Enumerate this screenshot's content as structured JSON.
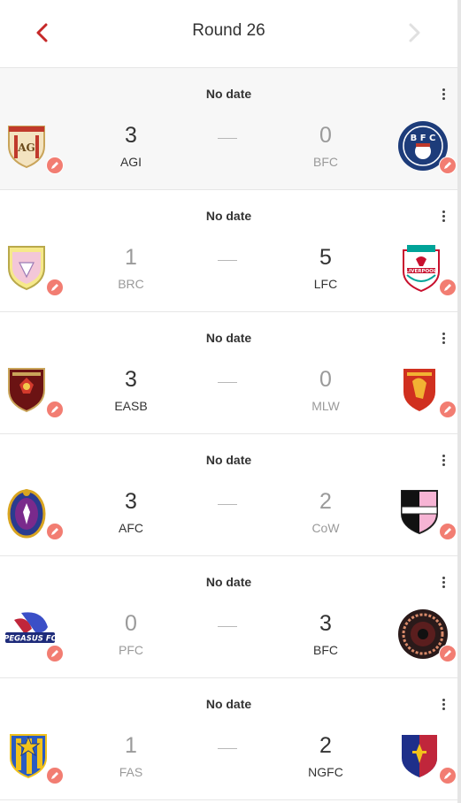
{
  "header": {
    "title": "Round 26",
    "prev_icon": "chevron-left-icon",
    "next_icon": "chevron-right-icon",
    "accent": "#c62828"
  },
  "matches": [
    {
      "date": "No date",
      "home": {
        "abbr": "AGI",
        "score": "3",
        "logo": "agi-crest"
      },
      "away": {
        "abbr": "BFC",
        "score": "0",
        "logo": "bfc-roundel"
      }
    },
    {
      "date": "No date",
      "home": {
        "abbr": "BRC",
        "score": "1",
        "logo": "brc-crest"
      },
      "away": {
        "abbr": "LFC",
        "score": "5",
        "logo": "lfc-crest"
      }
    },
    {
      "date": "No date",
      "home": {
        "abbr": "EASB",
        "score": "3",
        "logo": "easb-crest"
      },
      "away": {
        "abbr": "MLW",
        "score": "0",
        "logo": "mlw-crest"
      }
    },
    {
      "date": "No date",
      "home": {
        "abbr": "AFC",
        "score": "3",
        "logo": "afc-crest"
      },
      "away": {
        "abbr": "CoW",
        "score": "2",
        "logo": "cow-crest"
      }
    },
    {
      "date": "No date",
      "home": {
        "abbr": "PFC",
        "score": "0",
        "logo": "pegasus-fc-crest"
      },
      "away": {
        "abbr": "BFC",
        "score": "3",
        "logo": "bfc-wheel-crest"
      }
    },
    {
      "date": "No date",
      "home": {
        "abbr": "FAS",
        "score": "1",
        "logo": "fas-star-crest"
      },
      "away": {
        "abbr": "NGFC",
        "score": "2",
        "logo": "ngfc-shield"
      }
    }
  ],
  "colors": {
    "edit_badge": "#f27d72",
    "winner_text": "#333333",
    "loser_text": "#9a9a9a",
    "highlight_row": "#f7f7f7"
  },
  "logo_text": {
    "agi": "AG",
    "bfc": "B F C",
    "lfc": "LIVERPOOL",
    "pegasus": "PEGASUS FC"
  }
}
